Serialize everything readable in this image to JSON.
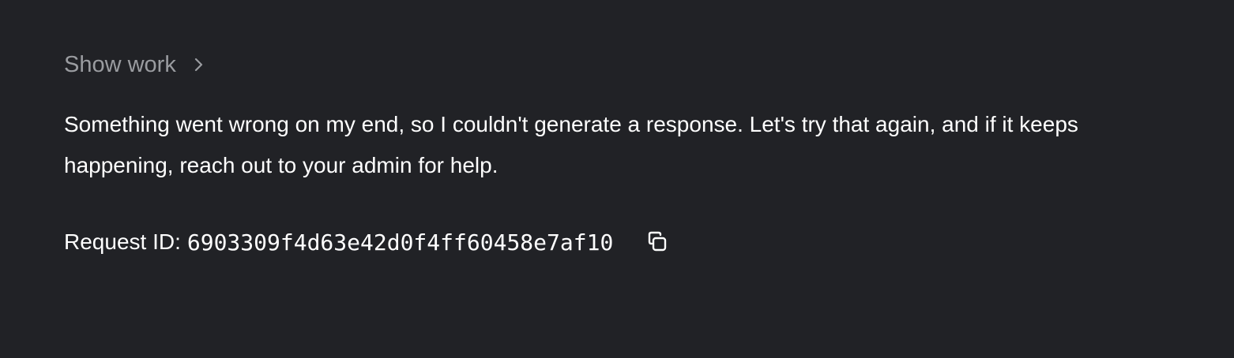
{
  "show_work": {
    "label": "Show work",
    "icon": "chevron-right-icon"
  },
  "message": {
    "text": "Something went wrong on my end, so I couldn't generate a response. Let's try that again, and if it keeps happening, reach out to your admin for help."
  },
  "request": {
    "label": "Request ID:",
    "id": "6903309f4d63e42d0f4ff60458e7af10",
    "copy_icon": "copy-icon"
  },
  "colors": {
    "background": "#212226",
    "text": "#ffffff",
    "muted": "#9a9ca0"
  }
}
